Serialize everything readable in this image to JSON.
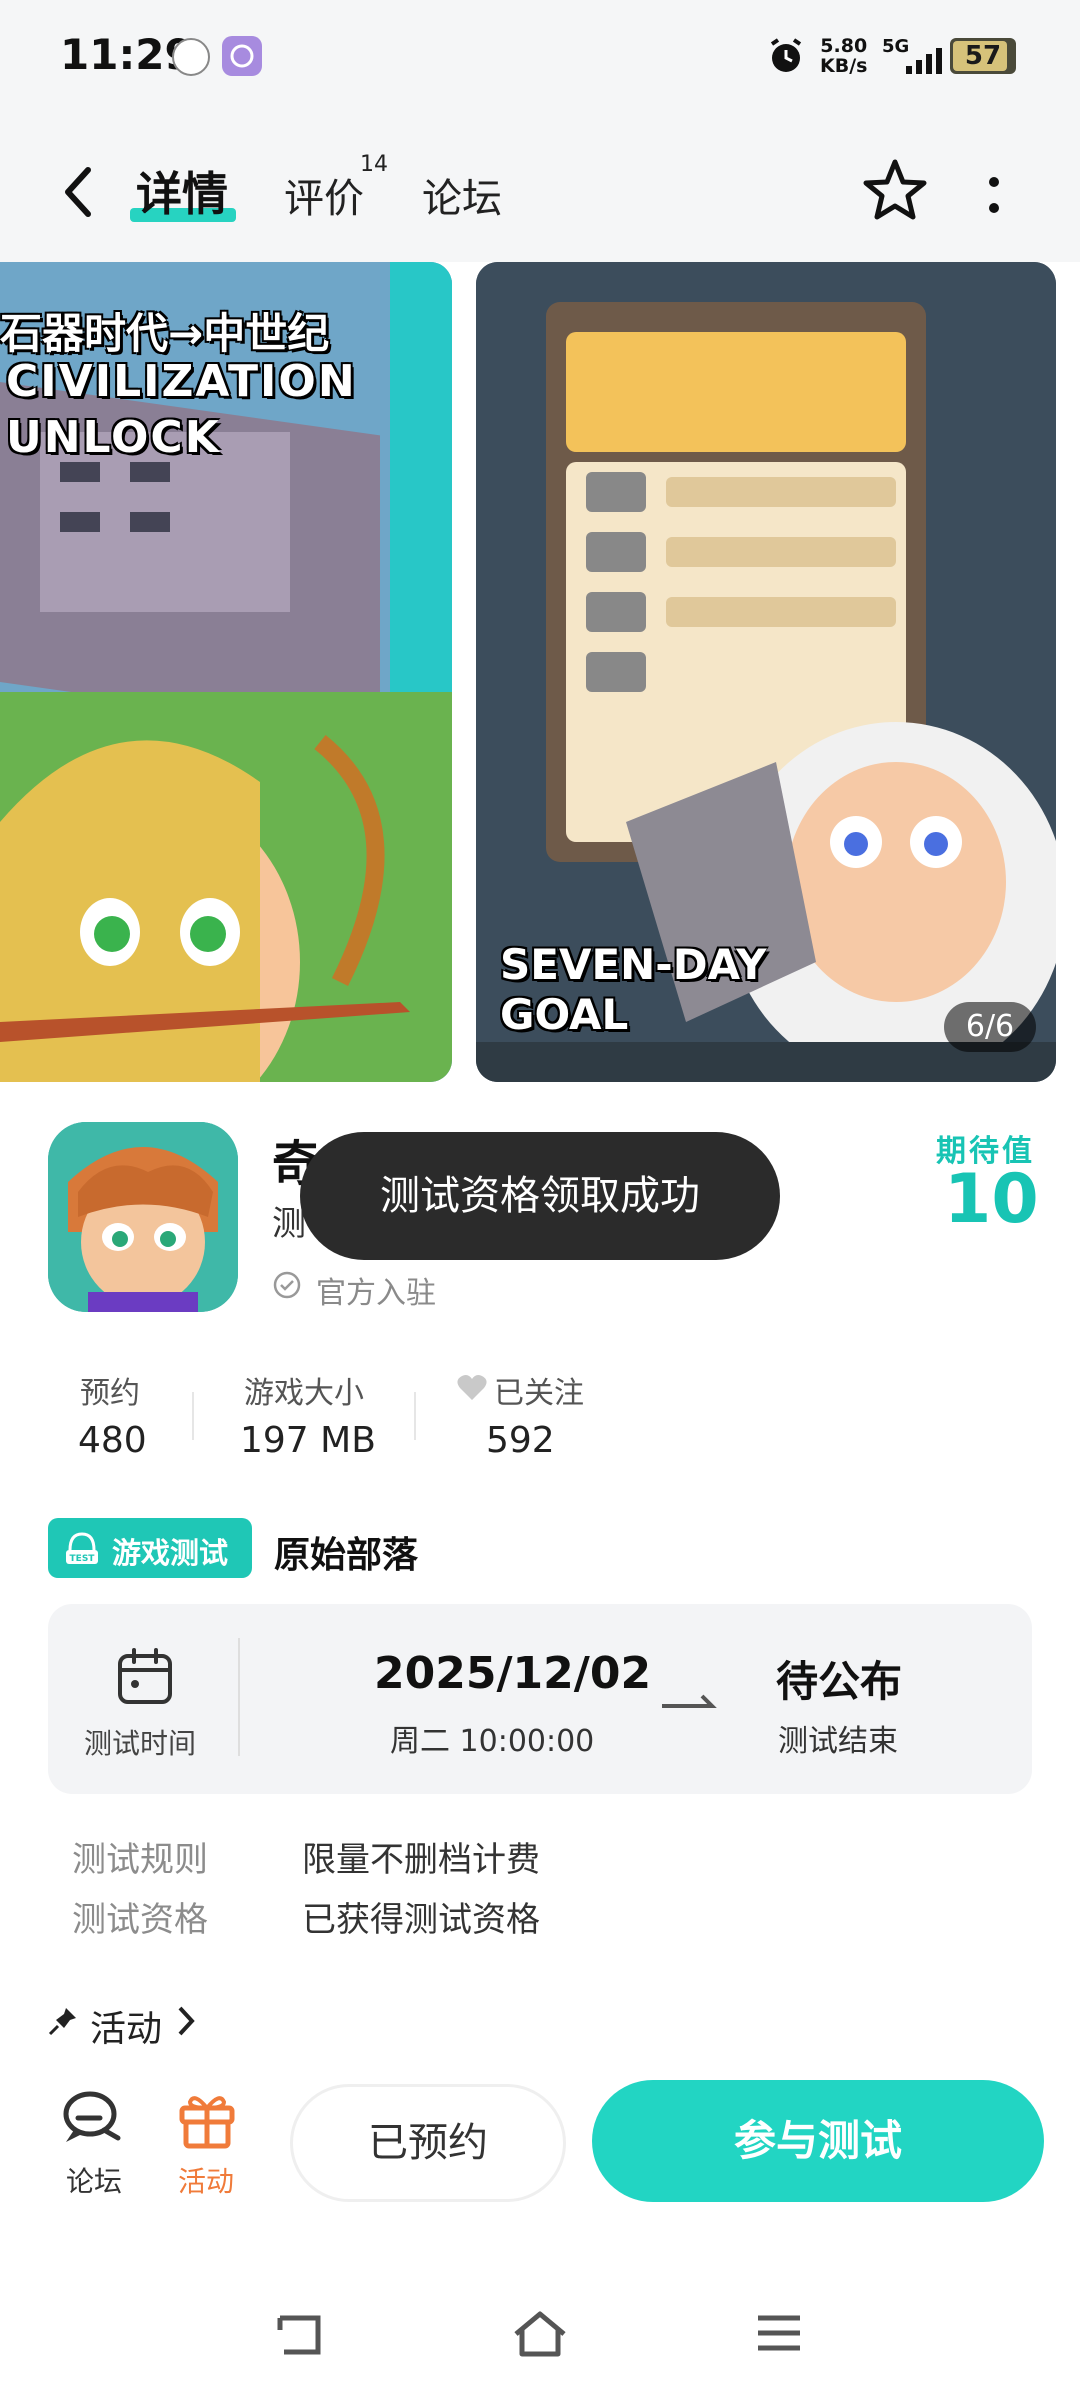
{
  "status_bar": {
    "time": "11:29",
    "net_speed_value": "5.80",
    "net_speed_unit": "KB/s",
    "network": "5G",
    "battery": "57",
    "icons": [
      "app-notification-icon",
      "app-notification-icon-2",
      "alarm-icon",
      "signal-icon",
      "battery-icon"
    ]
  },
  "nav": {
    "tabs": [
      {
        "label": "详情",
        "active": true
      },
      {
        "label": "评价",
        "count": "14"
      },
      {
        "label": "论坛"
      }
    ],
    "icons": [
      "back-icon",
      "star-outline-icon",
      "more-vertical-icon"
    ]
  },
  "gallery": {
    "counter": "6/6",
    "shot1_text": [
      "石器时代→中世纪",
      "CIVILIZATION",
      "UNLOCK"
    ],
    "shot2_text": [
      "SEVEN-DAY",
      "GOAL"
    ]
  },
  "app": {
    "name_visible": "奇",
    "subtitle_visible": "测",
    "verified": "官方入驻",
    "expect_label": "期待值",
    "expect_value": "10"
  },
  "toast": "测试资格领取成功",
  "stats": [
    {
      "label": "预约",
      "value": "480"
    },
    {
      "label": "游戏大小",
      "value": "197 MB"
    },
    {
      "label": "已关注",
      "value": "592"
    }
  ],
  "test": {
    "badge": "游戏测试",
    "name": "原始部落",
    "time_label": "测试时间",
    "start_date": "2025/12/02",
    "start_day": "周二  10:00:00",
    "end_title": "待公布",
    "end_sub": "测试结束",
    "rules": [
      {
        "label": "测试规则",
        "value": "限量不删档计费"
      },
      {
        "label": "测试资格",
        "value": "已获得测试资格"
      }
    ]
  },
  "activity": {
    "label": "活动"
  },
  "bottom_bar": {
    "forum_label": "论坛",
    "activity_label": "活动",
    "reserved_button": "已预约",
    "join_button": "参与测试"
  },
  "colors": {
    "accent": "#22d5c3",
    "toast_bg": "#2b2b2b",
    "activity_orange": "#f07b3a"
  }
}
